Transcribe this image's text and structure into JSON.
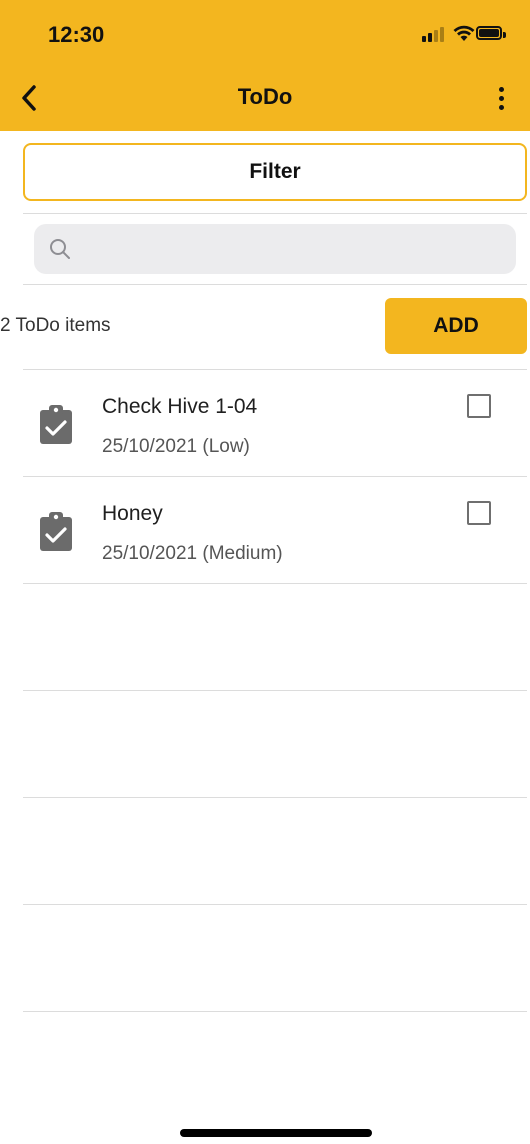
{
  "status_bar": {
    "time": "12:30"
  },
  "header": {
    "title": "ToDo",
    "back_icon": "chevron-left-icon",
    "menu_icon": "more-vertical-icon"
  },
  "filter": {
    "label": "Filter"
  },
  "search": {
    "placeholder": "",
    "value": "",
    "icon": "search-icon"
  },
  "summary": {
    "count_text": "2 ToDo items",
    "add_label": "ADD"
  },
  "todos": [
    {
      "title": "Check Hive 1-04",
      "subtitle": "25/10/2021 (Low)",
      "checked": false,
      "icon": "clipboard-check-icon"
    },
    {
      "title": "Honey",
      "subtitle": "25/10/2021 (Medium)",
      "checked": false,
      "icon": "clipboard-check-icon"
    }
  ],
  "colors": {
    "accent": "#f3b61f",
    "divider": "#dcdcdc",
    "search_bg": "#ececee"
  }
}
